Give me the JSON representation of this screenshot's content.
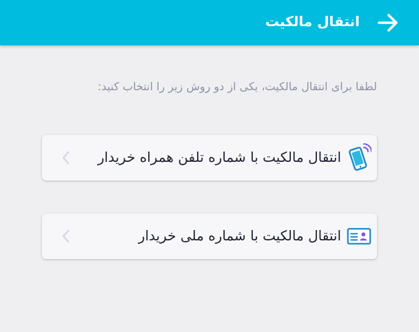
{
  "header": {
    "title": "انتقال مالکیت",
    "back_icon": "arrow-right-icon",
    "background": "#00bde0"
  },
  "instruction": "لطفا برای انتقال مالکیت، یکی از دو روش زیر را انتخاب کنید:",
  "options": [
    {
      "label": "انتقال مالکیت با شماره تلفن همراه خریدار",
      "icon": "mobile-phone-icon",
      "chevron": "chevron-left-icon"
    },
    {
      "label": "انتقال مالکیت با شماره ملی خریدار",
      "icon": "id-card-icon",
      "chevron": "chevron-left-icon"
    }
  ],
  "colors": {
    "accent": "#00bde0",
    "icon_blue": "#1b86c8",
    "page_background": "#efeff1"
  }
}
